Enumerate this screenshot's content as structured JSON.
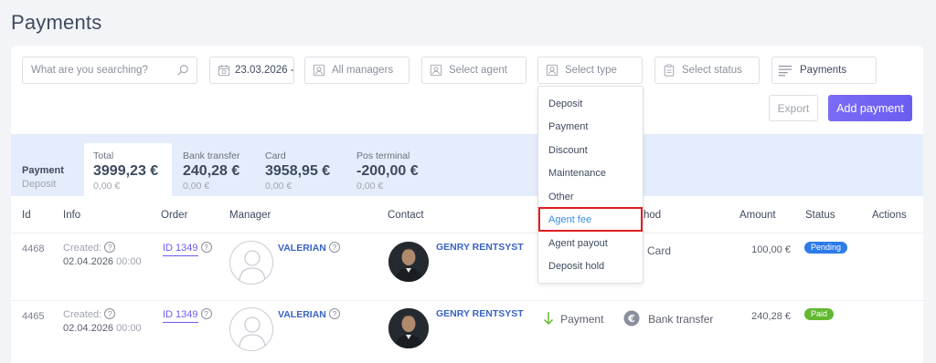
{
  "page": {
    "title": "Payments"
  },
  "filters": {
    "search_placeholder": "What are you searching?",
    "date": "23.03.2026 -",
    "managers": "All managers",
    "agent": "Select agent",
    "type": "Select type",
    "status": "Select status",
    "view": "Payments"
  },
  "actions": {
    "export": "Export",
    "add_payment": "Add payment"
  },
  "summary": {
    "label": "Payment",
    "sublabel": "Deposit",
    "columns": [
      {
        "header": "Total",
        "value": "3999,23 €",
        "sub": "0,00 €"
      },
      {
        "header": "Bank transfer",
        "value": "240,28 €",
        "sub": "0,00 €"
      },
      {
        "header": "Card",
        "value": "3958,95 €",
        "sub": "0,00 €"
      },
      {
        "header": "Pos terminal",
        "value": "-200,00 €",
        "sub": "0,00 €"
      }
    ]
  },
  "table": {
    "headers": {
      "id": "Id",
      "info": "Info",
      "order": "Order",
      "manager": "Manager",
      "contact": "Contact",
      "method": "hod",
      "amount": "Amount",
      "status": "Status",
      "actions": "Actions"
    },
    "rows": [
      {
        "id": "4468",
        "created_label": "Created:",
        "date": "02.04.2026",
        "time": "00:00",
        "order": "ID 1349",
        "manager": "VALERIAN",
        "contact": "GENRY RENTSYST",
        "type": "",
        "method": "Card",
        "amount": "100,00 €",
        "status": "Pending"
      },
      {
        "id": "4465",
        "created_label": "Created:",
        "date": "02.04.2026",
        "time": "00:00",
        "order": "ID 1349",
        "manager": "VALERIAN",
        "contact": "GENRY RENTSYST",
        "type": "Payment",
        "method": "Bank transfer",
        "amount": "240,28 €",
        "status": "Paid"
      }
    ]
  },
  "type_dropdown": {
    "items": [
      "Deposit",
      "Payment",
      "Discount",
      "Maintenance",
      "Other",
      "Agent fee",
      "Agent payout",
      "Deposit hold"
    ],
    "highlighted": "Agent fee"
  },
  "colors": {
    "accent": "#6a5cf0",
    "link": "#3a62c6",
    "pending": "#2d7be8",
    "paid": "#62b930",
    "highlight_border": "#e31c1c"
  },
  "icons": {
    "search": "search-icon",
    "date": "calendar-icon",
    "managers": "user-card-icon",
    "agent": "user-card-icon",
    "type": "user-card-icon",
    "status": "clipboard-icon",
    "view": "list-icon",
    "payment_type": "arrow-down-icon",
    "method": "euro-coin-icon"
  }
}
